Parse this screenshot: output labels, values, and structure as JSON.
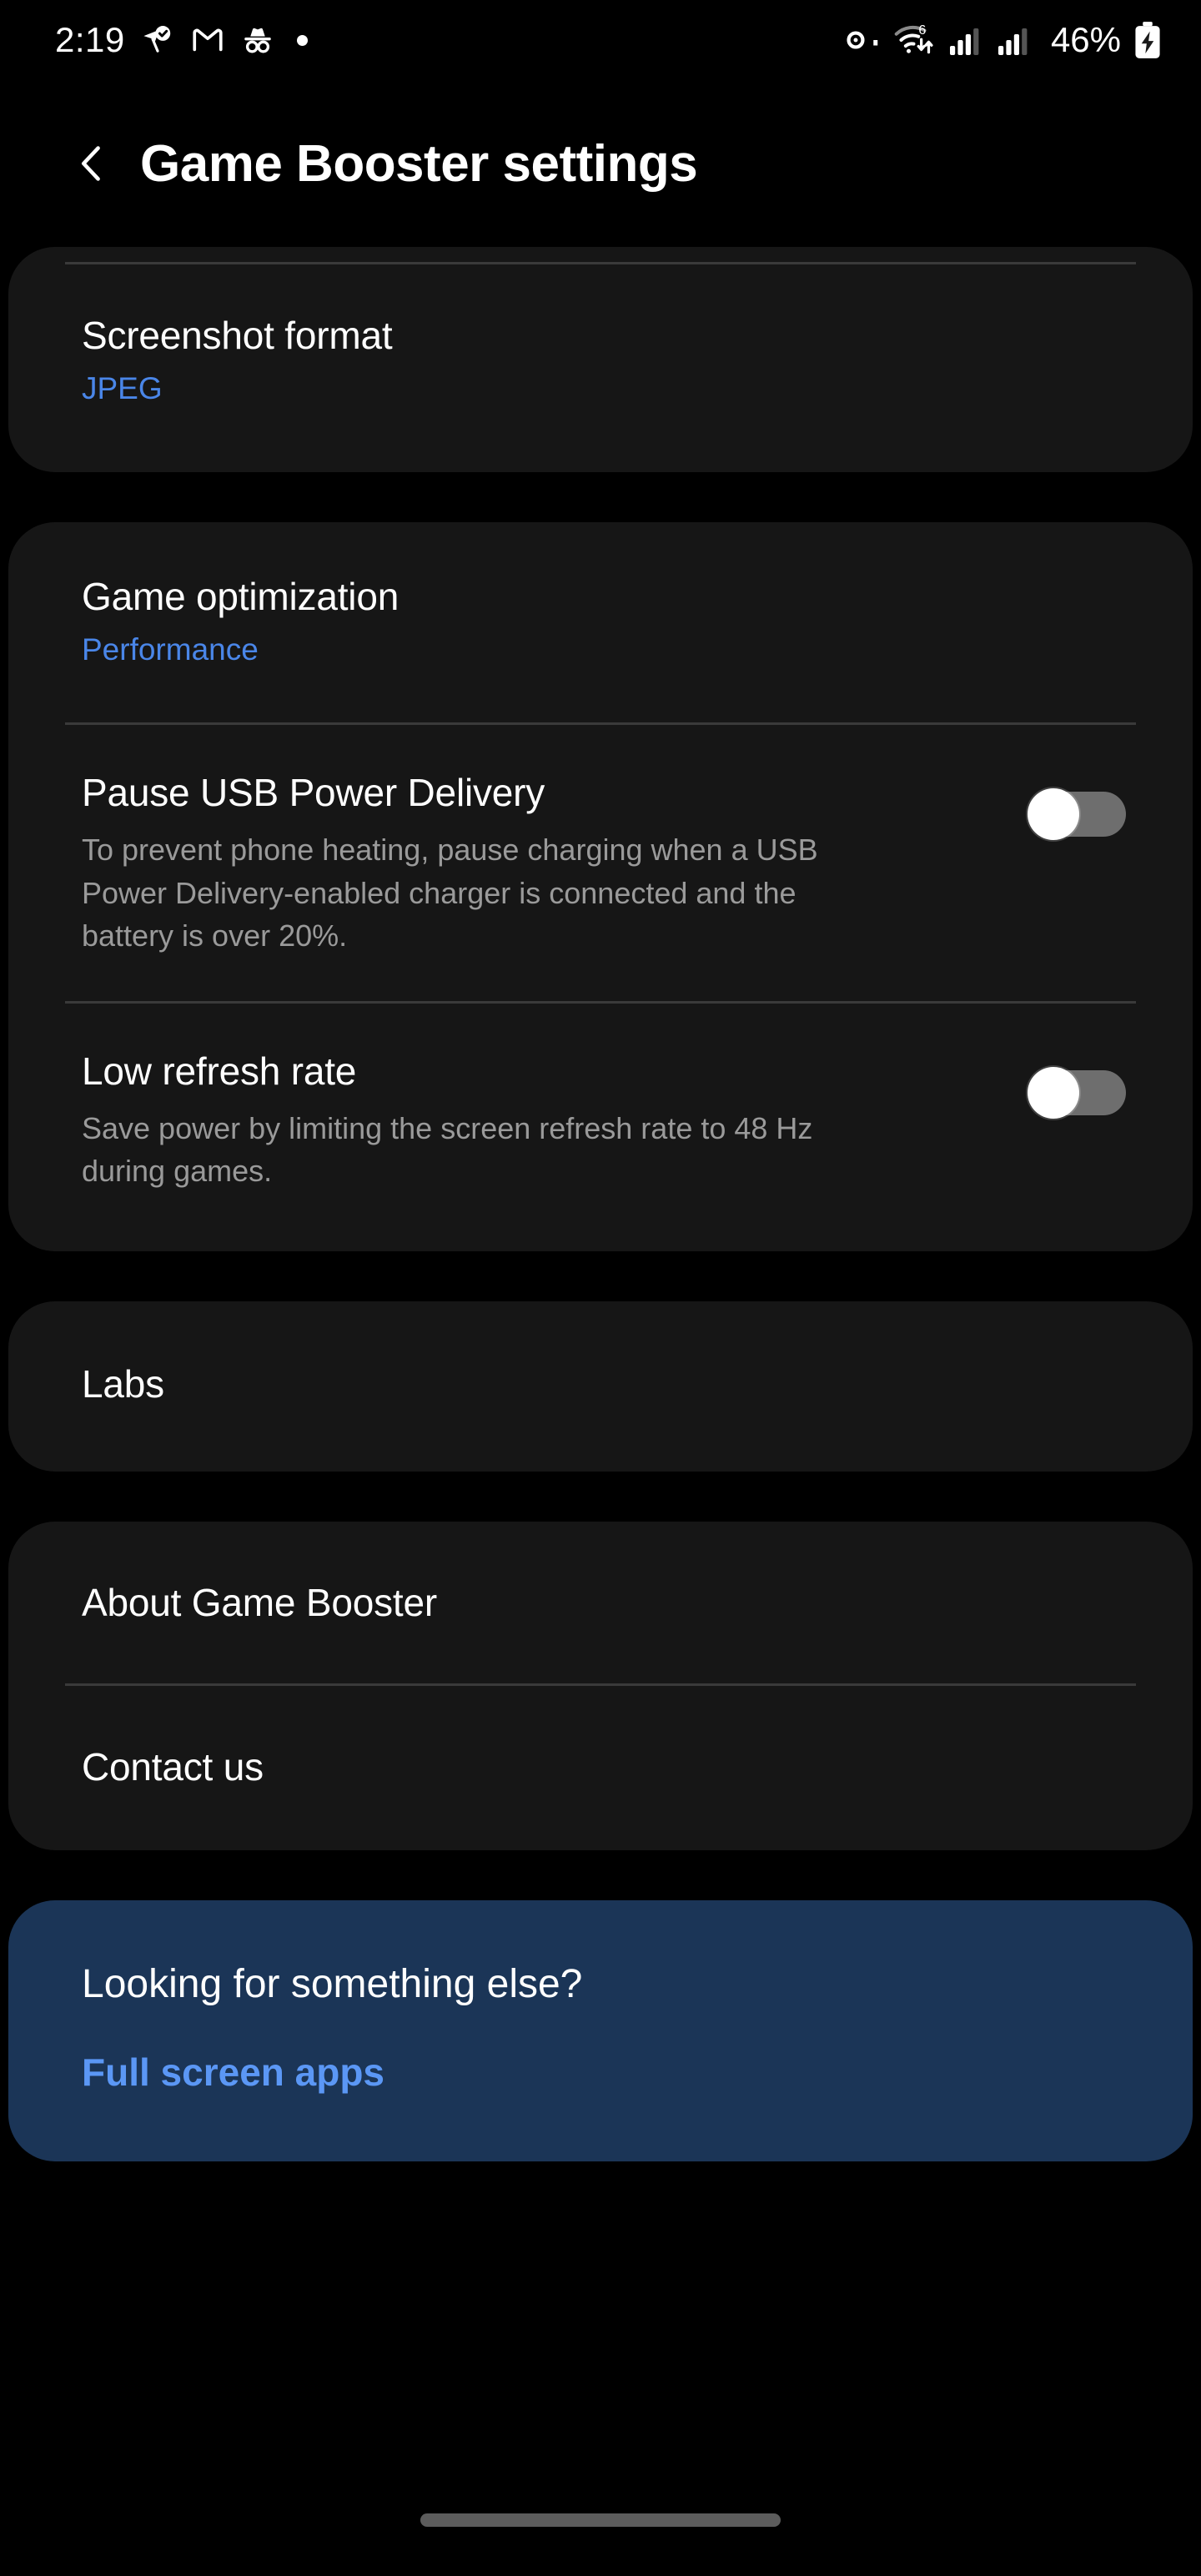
{
  "status_bar": {
    "clock": "2:19",
    "battery_percent": "46%",
    "left_icons": [
      {
        "name": "location-sharing-verified-icon"
      },
      {
        "name": "gmail-icon"
      },
      {
        "name": "incognito-icon"
      },
      {
        "name": "notification-dot-icon"
      }
    ],
    "right_icons": [
      {
        "name": "vpn-key-icon"
      },
      {
        "name": "wifi-6-data-transfer-icon"
      },
      {
        "name": "signal-bars-sim1-icon"
      },
      {
        "name": "signal-bars-sim2-icon"
      },
      {
        "name": "battery-charging-icon"
      }
    ]
  },
  "app_bar": {
    "back_label": "Back",
    "title": "Game Booster settings"
  },
  "cards": {
    "screenshot": {
      "title": "Screenshot format",
      "value": "JPEG"
    },
    "optimization": {
      "title": "Game optimization",
      "value": "Performance"
    },
    "usb": {
      "title": "Pause USB Power Delivery",
      "desc": "To prevent phone heating, pause charging when a USB Power Delivery-enabled charger is connected and the battery is over 20%.",
      "toggle_state": "off"
    },
    "refresh": {
      "title": "Low refresh rate",
      "desc": "Save power by limiting the screen refresh rate to 48 Hz during games.",
      "toggle_state": "off"
    },
    "labs": {
      "title": "Labs"
    },
    "about": {
      "title": "About Game Booster"
    },
    "contact": {
      "title": "Contact us"
    },
    "promo": {
      "title": "Looking for something else?",
      "link": "Full screen apps"
    }
  },
  "colors": {
    "accent_blue": "#4a86e8",
    "link_blue": "#5b97f5",
    "card_bg": "#161616",
    "promo_bg": "#1b3557",
    "page_bg": "#000000",
    "secondary_text": "#9a9a9a"
  }
}
